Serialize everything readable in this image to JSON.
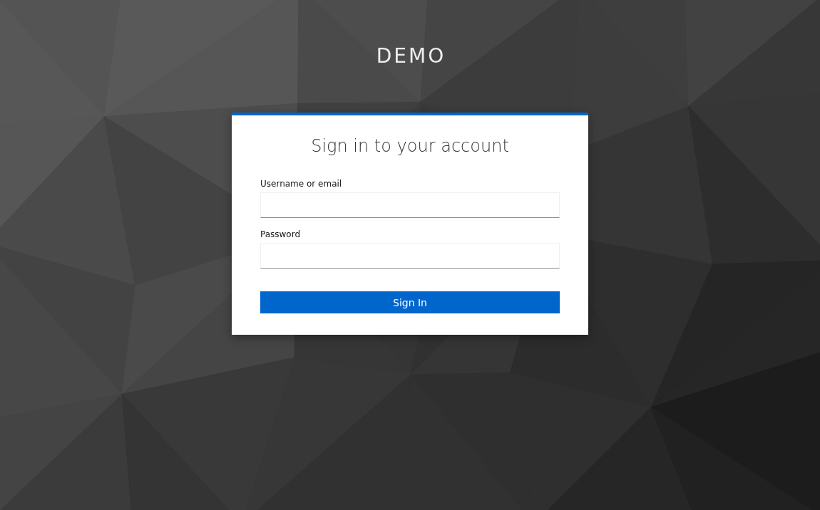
{
  "header": {
    "title": "DEMO"
  },
  "login_card": {
    "title": "Sign in to your account",
    "fields": [
      {
        "label": "Username or email"
      },
      {
        "label": "Password"
      }
    ],
    "submit_button": "Sign In"
  }
}
